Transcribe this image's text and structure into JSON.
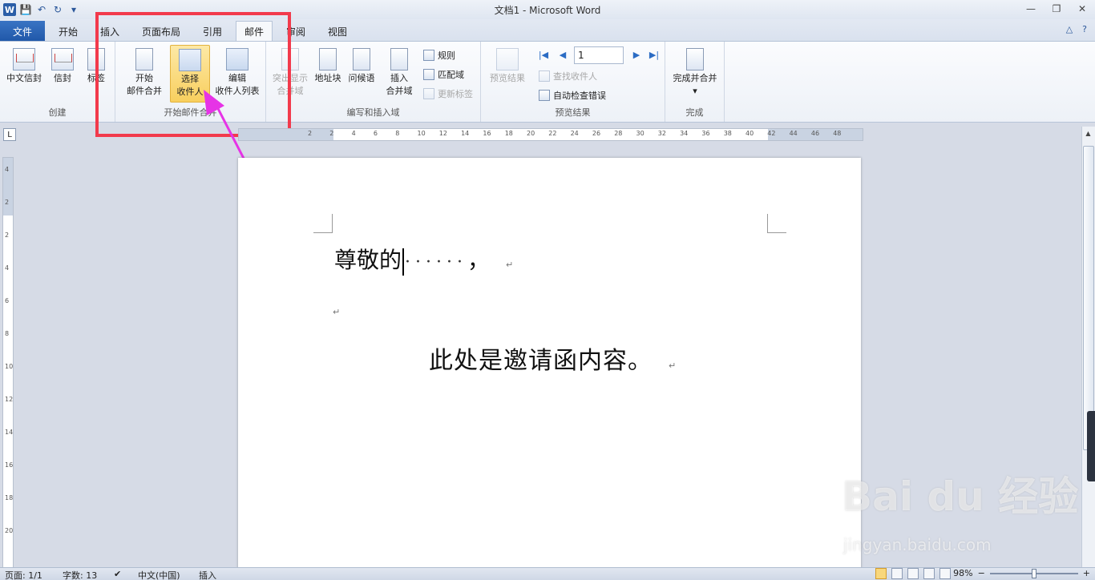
{
  "window": {
    "title": "文档1 - Microsoft Word",
    "logo": "W",
    "minimize": "—",
    "restore": "❐",
    "close": "✕"
  },
  "qat": {
    "save": "💾",
    "undo": "↶",
    "redo": "↻",
    "customize": "▾"
  },
  "tabs": {
    "file": "文件",
    "items": [
      "开始",
      "插入",
      "页面布局",
      "引用",
      "邮件",
      "审阅",
      "视图"
    ],
    "active": "邮件",
    "help": "?",
    "collapse": "△"
  },
  "ribbon": {
    "create": {
      "label": "创建",
      "chinese_envelope": "中文信封",
      "envelope": "信封",
      "labels": "标签"
    },
    "start_merge": {
      "label": "开始邮件合并",
      "start_line1": "开始",
      "start_line2": "邮件合并",
      "select_line1": "选择",
      "select_line2": "收件人",
      "edit_line1": "编辑",
      "edit_line2": "收件人列表"
    },
    "write_insert": {
      "label": "编写和插入域",
      "highlight_line1": "突出显示",
      "highlight_line2": "合并域",
      "address_block": "地址块",
      "greeting": "问候语",
      "insert_line1": "插入",
      "insert_line2": "合并域",
      "rules": "规则",
      "match_fields": "匹配域",
      "update_labels": "更新标签"
    },
    "preview": {
      "label": "预览结果",
      "preview_results": "预览结果",
      "record": "1",
      "find_recipient": "查找收件人",
      "auto_check": "自动检查错误"
    },
    "finish": {
      "label": "完成",
      "finish_merge": "完成并合并"
    }
  },
  "ruler": {
    "ticks": [
      "2",
      "2",
      "4",
      "6",
      "8",
      "10",
      "12",
      "14",
      "16",
      "18",
      "20",
      "22",
      "24",
      "26",
      "28",
      "30",
      "32",
      "34",
      "36",
      "38",
      "40",
      "42",
      "44",
      "46",
      "48"
    ],
    "vticks": [
      "4",
      "2",
      "2",
      "4",
      "6",
      "8",
      "10",
      "12",
      "14",
      "16",
      "18",
      "20"
    ],
    "tab_selector": "L"
  },
  "document": {
    "line1_text": "尊敬的",
    "line1_dots": "······",
    "line1_comma": "，",
    "para_mark": "↵",
    "line2_text": "此处是邀请函内容。"
  },
  "status": {
    "page": "页面: 1/1",
    "words": "字数: 13",
    "language": "中文(中国)",
    "mode": "插入",
    "zoom": "98%",
    "zoom_minus": "−",
    "zoom_plus": "+"
  },
  "watermark": {
    "brand": "Bai du 经验",
    "url": "jingyan.baidu.com"
  },
  "colors": {
    "accent": "#2b579a",
    "highlight_box": "#f23a4c",
    "arrow": "#e633e6",
    "selected_button": "#f8cf5e"
  }
}
